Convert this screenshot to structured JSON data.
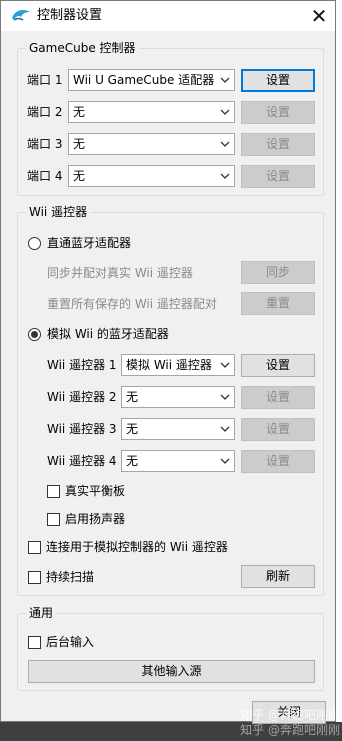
{
  "window": {
    "title": "控制器设置",
    "close_glyph": "✕"
  },
  "gamecube": {
    "title": "GameCube 控制器",
    "ports": [
      {
        "label": "端口 1",
        "value": "Wii U GameCube 适配器",
        "button": "设置",
        "enabled": true
      },
      {
        "label": "端口 2",
        "value": "无",
        "button": "设置",
        "enabled": false
      },
      {
        "label": "端口 3",
        "value": "无",
        "button": "设置",
        "enabled": false
      },
      {
        "label": "端口 4",
        "value": "无",
        "button": "设置",
        "enabled": false
      }
    ]
  },
  "wii": {
    "title": "Wii 遥控器",
    "passthrough_label": "直通蓝牙适配器",
    "sync_label": "同步并配对真实 Wii 遥控器",
    "sync_button": "同步",
    "reset_label": "重置所有保存的 Wii 遥控器配对",
    "reset_button": "重置",
    "emulated_label": "模拟 Wii 的蓝牙适配器",
    "remotes": [
      {
        "label": "Wii 遥控器 1",
        "value": "模拟 Wii 遥控器",
        "button": "设置",
        "enabled": true
      },
      {
        "label": "Wii 遥控器 2",
        "value": "无",
        "button": "设置",
        "enabled": false
      },
      {
        "label": "Wii 遥控器 3",
        "value": "无",
        "button": "设置",
        "enabled": false
      },
      {
        "label": "Wii 遥控器 4",
        "value": "无",
        "button": "设置",
        "enabled": false
      }
    ],
    "balance_board_label": "真实平衡板",
    "speaker_label": "启用扬声器",
    "connect_label": "连接用于模拟控制器的 Wii 遥控器",
    "continuous_scan_label": "持续扫描",
    "refresh_button": "刷新"
  },
  "general": {
    "title": "通用",
    "background_input_label": "后台输入",
    "other_sources_button": "其他输入源"
  },
  "close_button": "关闭",
  "watermark": {
    "line1": "知乎 @奔跑吧刚刚",
    "line2": "知乎 @奔跑吧刚刚"
  },
  "colors": {
    "accent": "#0078d7",
    "dialog_bg": "#f0f0f0",
    "disabled_text": "#8a8a8a"
  }
}
